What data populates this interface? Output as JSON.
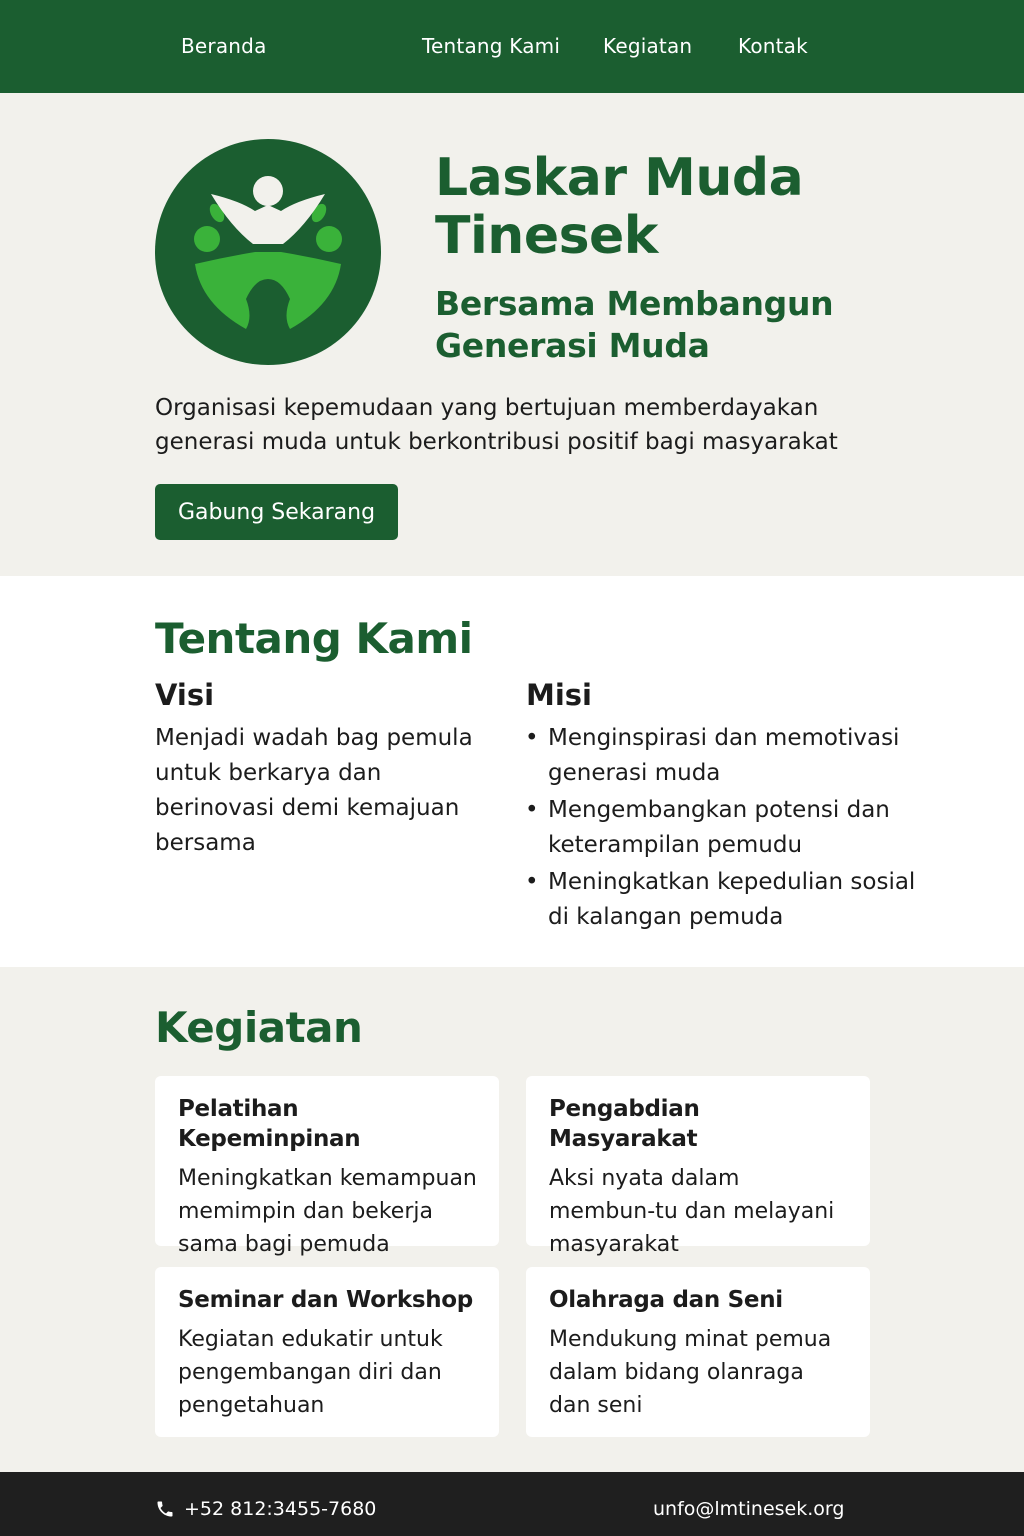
{
  "nav": {
    "items": [
      {
        "label": "Beranda"
      },
      {
        "label": "Tentang Kami"
      },
      {
        "label": "Kegiatan"
      },
      {
        "label": "Kontak"
      }
    ]
  },
  "hero": {
    "title": "Laskar Muda Tinesek",
    "subtitle": "Bersama Membangun Generasi Muda",
    "description": "Organisasi kepemudaan yang bertujuan memberdayakan generasi muda untuk berkontribusi positif bagi masyarakat",
    "cta_label": "Gabung Sekarang",
    "logo_icon": "people-unity-icon"
  },
  "about": {
    "title": "Tentang Kami",
    "visi": {
      "heading": "Visi",
      "text": "Menjadi wadah bag pemula untuk berkarya dan berinovasi demi kemajuan bersama"
    },
    "misi": {
      "heading": "Misi",
      "items": [
        "Menginspirasi dan memotivasi generasi muda",
        "Mengembangkan potensi dan keterampilan pemudu",
        "Meningkatkan kepedulian sosial di kalangan pemuda"
      ]
    }
  },
  "kegiatan": {
    "title": "Kegiatan",
    "cards": [
      {
        "title": "Pelatihan Kepeminpinan",
        "description": "Meningkatkan kemampuan memimpin dan bekerja sama bagi pemuda"
      },
      {
        "title": "Pengabdian Masyarakat",
        "description": "Aksi nyata dalam membun-tu dan melayani masyarakat"
      },
      {
        "title": "Seminar dan Workshop",
        "description": "Kegiatan edukatir untuk pengembangan diri dan pengetahuan"
      },
      {
        "title": "Olahraga dan Seni",
        "description": "Mendukung minat pemua dalam bidang olanraga dan seni"
      }
    ]
  },
  "footer": {
    "phone": "+52  812:3455-7680",
    "phone_icon": "phone-icon",
    "email": "unfo@lmtinesek.org"
  },
  "colors": {
    "primary_green": "#1b5e30",
    "light_green": "#3ab23a",
    "background": "#f2f1ec",
    "footer": "#1f1f1f"
  }
}
